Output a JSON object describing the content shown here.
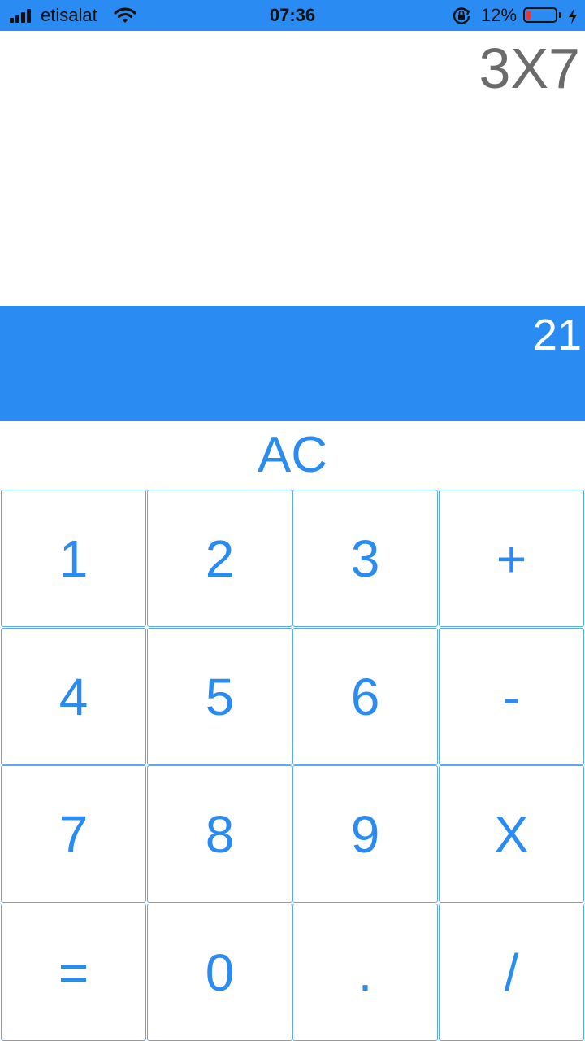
{
  "status_bar": {
    "carrier": "etisalat",
    "time": "07:36",
    "battery_percent": "12%",
    "battery_level": 0.12,
    "icons": [
      "signal-icon",
      "wifi-icon",
      "rotation-lock-icon",
      "battery-icon",
      "charging-bolt-icon"
    ]
  },
  "display": {
    "expression": "3X7",
    "result": "21"
  },
  "controls": {
    "clear_label": "AC"
  },
  "keypad": {
    "keys": [
      {
        "label": "1",
        "name": "key-1"
      },
      {
        "label": "2",
        "name": "key-2"
      },
      {
        "label": "3",
        "name": "key-3"
      },
      {
        "label": "+",
        "name": "key-add"
      },
      {
        "label": "4",
        "name": "key-4"
      },
      {
        "label": "5",
        "name": "key-5"
      },
      {
        "label": "6",
        "name": "key-6"
      },
      {
        "label": "-",
        "name": "key-subtract"
      },
      {
        "label": "7",
        "name": "key-7"
      },
      {
        "label": "8",
        "name": "key-8"
      },
      {
        "label": "9",
        "name": "key-9"
      },
      {
        "label": "X",
        "name": "key-multiply"
      },
      {
        "label": "=",
        "name": "key-equals"
      },
      {
        "label": "0",
        "name": "key-0"
      },
      {
        "label": ".",
        "name": "key-decimal"
      },
      {
        "label": "/",
        "name": "key-divide"
      }
    ]
  },
  "colors": {
    "accent": "#2a8cf3",
    "expression_text": "#6b6b6b",
    "key_border": "#5aa9f5",
    "battery_low": "#e8353b"
  }
}
